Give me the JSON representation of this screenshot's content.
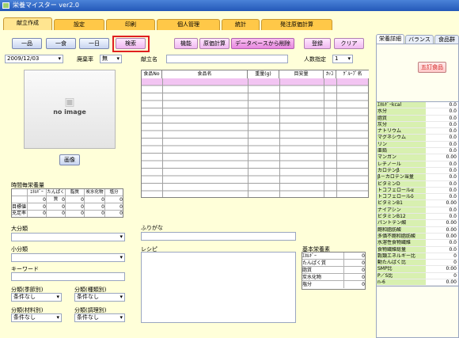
{
  "window": {
    "title": "栄養マイスター ver2.0"
  },
  "tabs": [
    "献立作成",
    "設定",
    "印刷",
    "個人管理",
    "統計",
    "発注原価計算"
  ],
  "toolbar": {
    "ippin": "一品",
    "isshoku": "一食",
    "ichinichi": "一日",
    "search": "検索",
    "func": "機能",
    "genka": "原価計算",
    "delete_db": "データベースから削除",
    "register": "登録",
    "clear": "クリア"
  },
  "date": {
    "value": "2009/12/03"
  },
  "haiki": {
    "label": "廃棄率",
    "value": "無"
  },
  "kondate": {
    "label": "献立名",
    "value": ""
  },
  "ninzu": {
    "label": "人数指定",
    "value": "1"
  },
  "image": {
    "placeholder": "no image",
    "button": "画像"
  },
  "ingredients": {
    "headers": [
      "食品No",
      "食品名",
      "重量(g)",
      "目安量",
      "ｶｯｺ",
      "ｸﾞﾙｰﾌﾟ名"
    ]
  },
  "jikan": {
    "title": "時間毎栄養量",
    "headers": [
      "ｴﾈﾙｷﾞｰ",
      "たんぱく質",
      "脂質",
      "炭水化物",
      "塩分"
    ],
    "rows": [
      {
        "label": "",
        "values": [
          "0",
          "0",
          "0",
          "0",
          "0"
        ]
      },
      {
        "label": "目標値",
        "values": [
          "0",
          "0",
          "0",
          "0",
          "0"
        ]
      },
      {
        "label": "充足率",
        "values": [
          "0",
          "0",
          "0",
          "0",
          "0"
        ]
      }
    ]
  },
  "daibunrui": {
    "label": "大分類"
  },
  "shobunrui": {
    "label": "小分類"
  },
  "keyword": {
    "label": "キーワード"
  },
  "bunrui": [
    {
      "label": "分類(季節別)",
      "value": "条件なし"
    },
    {
      "label": "分類(種類別)",
      "value": "条件なし"
    },
    {
      "label": "分類(材料別)",
      "value": "条件なし"
    },
    {
      "label": "分類(調理別)",
      "value": "条件なし"
    }
  ],
  "furigana": {
    "label": "ふりがな"
  },
  "recipe": {
    "label": "レシピ"
  },
  "kihon": {
    "title": "基本栄養素",
    "rows": [
      {
        "name": "ｴﾈﾙｷﾞｰ",
        "value": "0"
      },
      {
        "name": "たんぱく質",
        "value": "0"
      },
      {
        "name": "脂質",
        "value": "0"
      },
      {
        "name": "炭水化物",
        "value": "0"
      },
      {
        "name": "塩分",
        "value": "0"
      }
    ]
  },
  "right_tabs": [
    "栄養詳細",
    "バランス",
    "食品群"
  ],
  "right_button": "五訂食品",
  "nutrients": [
    {
      "name": "ｴﾈﾙｷﾞｰkcal",
      "value": "0.0"
    },
    {
      "name": "水分",
      "value": "0.0"
    },
    {
      "name": "脂質",
      "value": "0.0"
    },
    {
      "name": "灰分",
      "value": "0.0"
    },
    {
      "name": "ナトリウム",
      "value": "0.0"
    },
    {
      "name": "マグネシウム",
      "value": "0.0"
    },
    {
      "name": "リン",
      "value": "0.0"
    },
    {
      "name": "亜鉛",
      "value": "0.0"
    },
    {
      "name": "マンガン",
      "value": "0.00"
    },
    {
      "name": "レチノール",
      "value": "0.0"
    },
    {
      "name": "カロテンβ",
      "value": "0.0"
    },
    {
      "name": "β－カロテン当量",
      "value": "0.0"
    },
    {
      "name": "ビタミンD",
      "value": "0.0"
    },
    {
      "name": "トコフェロールα",
      "value": "0.0"
    },
    {
      "name": "トコフェロールδ",
      "value": "0.0"
    },
    {
      "name": "ビタミンB1",
      "value": "0.00"
    },
    {
      "name": "ナイアシン",
      "value": "0.0"
    },
    {
      "name": "ビタミンB12",
      "value": "0.0"
    },
    {
      "name": "パントテン酸",
      "value": "0.00"
    },
    {
      "name": "飽和脂肪酸",
      "value": "0.00"
    },
    {
      "name": "多価不飽和脂肪酸",
      "value": "0.00"
    },
    {
      "name": "水溶性食物繊維",
      "value": "0.0"
    },
    {
      "name": "食物繊維総量",
      "value": "0.0"
    },
    {
      "name": "穀類エネルギー比",
      "value": "0"
    },
    {
      "name": "動たんぱく比",
      "value": "0"
    },
    {
      "name": "SMP比",
      "value": "0:00"
    },
    {
      "name": "P／S比",
      "value": "0"
    },
    {
      "name": "n-6",
      "value": "0.00"
    }
  ]
}
